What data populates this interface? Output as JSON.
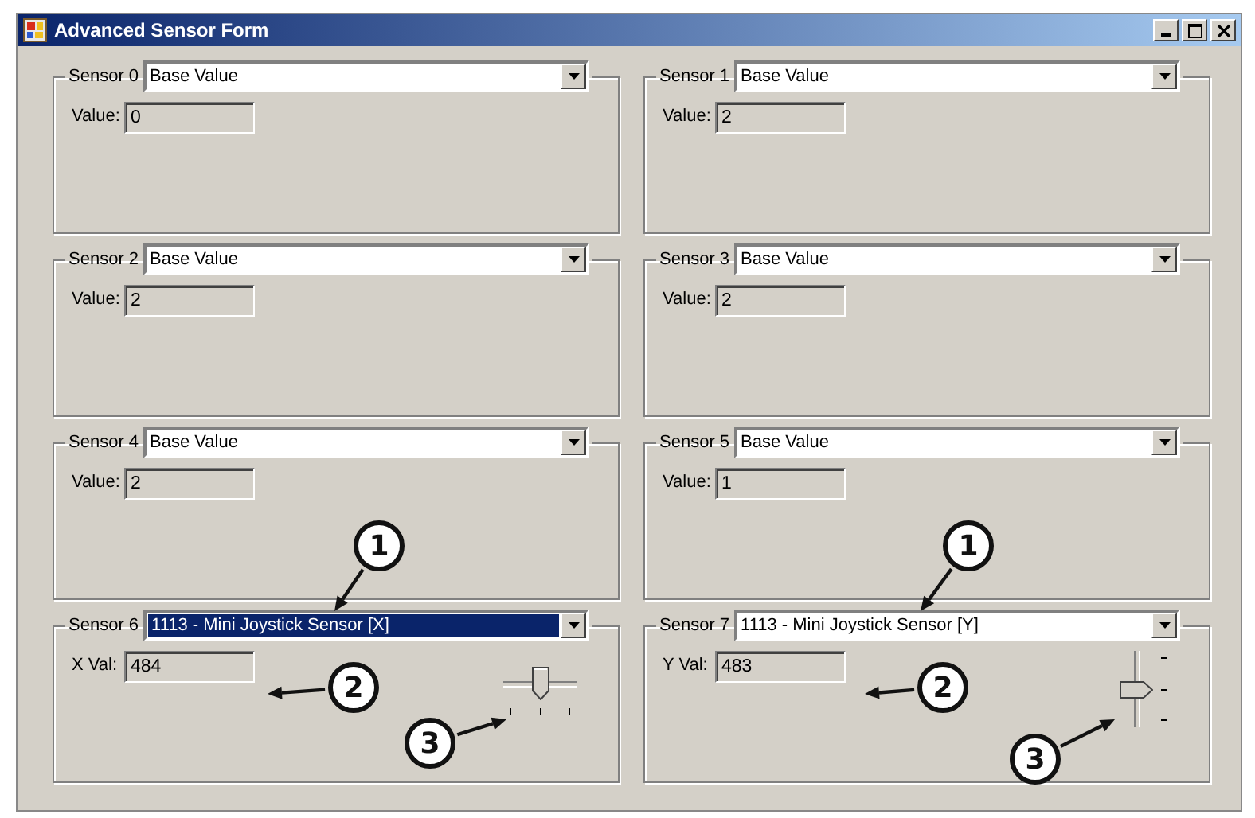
{
  "window": {
    "title": "Advanced Sensor Form"
  },
  "sensors": [
    {
      "label": "Sensor 0",
      "selection": "Base Value",
      "focused": false,
      "value_label": "Value:",
      "value": "0"
    },
    {
      "label": "Sensor 1",
      "selection": "Base Value",
      "focused": false,
      "value_label": "Value:",
      "value": "2"
    },
    {
      "label": "Sensor 2",
      "selection": "Base Value",
      "focused": false,
      "value_label": "Value:",
      "value": "2"
    },
    {
      "label": "Sensor 3",
      "selection": "Base Value",
      "focused": false,
      "value_label": "Value:",
      "value": "2"
    },
    {
      "label": "Sensor 4",
      "selection": "Base Value",
      "focused": false,
      "value_label": "Value:",
      "value": "2"
    },
    {
      "label": "Sensor 5",
      "selection": "Base Value",
      "focused": false,
      "value_label": "Value:",
      "value": "1"
    },
    {
      "label": "Sensor 6",
      "selection": "1113 - Mini Joystick Sensor [X]",
      "focused": true,
      "value_label": "X Val:",
      "value": "484",
      "slider": {
        "kind": "horizontal",
        "level": 0.5
      }
    },
    {
      "label": "Sensor 7",
      "selection": "1113 - Mini Joystick Sensor [Y]",
      "focused": false,
      "value_label": "Y Val:",
      "value": "483",
      "slider": {
        "kind": "vertical",
        "level": 0.5
      }
    }
  ],
  "callouts": [
    {
      "number": "1"
    },
    {
      "number": "1"
    },
    {
      "number": "2"
    },
    {
      "number": "2"
    },
    {
      "number": "3"
    },
    {
      "number": "3"
    }
  ]
}
